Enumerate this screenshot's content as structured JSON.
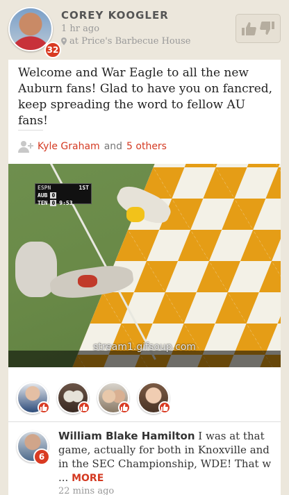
{
  "post": {
    "author": "COREY KOOGLER",
    "time": "1 hr ago",
    "location": "at Price's Barbecue House",
    "badge_count": "32",
    "message": "Welcome and War Eagle to all the new Auburn fans! Glad to have you on fancred, keep spreading the word to fellow AU fans!",
    "likers": {
      "name": "Kyle Graham",
      "connector": "and",
      "others": "5 others"
    },
    "media": {
      "watermark": "stream1.gifsoup.com",
      "scorebug": {
        "period": "1ST",
        "team1": "AUB",
        "score1": "0",
        "team2": "TEN",
        "score2": "0",
        "clock": "9:53"
      }
    },
    "like_avatars": [
      {
        "name": "like-avatar-1",
        "color": "#c9d4de"
      },
      {
        "name": "like-avatar-2",
        "color": "#8a6a5a"
      },
      {
        "name": "like-avatar-3",
        "color": "#b8a38c"
      },
      {
        "name": "like-avatar-4",
        "color": "#a07a62"
      }
    ]
  },
  "comment": {
    "author": "William Blake Hamilton",
    "text": "I was at that game, actually for both in Knoxville and in the SEC Championship, WDE!  That w",
    "ellipsis": "...",
    "more": "MORE",
    "time": "22 mins ago",
    "badge_count": "6"
  },
  "colors": {
    "accent": "#d43a22",
    "background": "#ece7dc"
  },
  "icons": [
    "location-pin-icon",
    "thumbs-up-icon",
    "thumbs-down-icon",
    "add-person-icon"
  ]
}
